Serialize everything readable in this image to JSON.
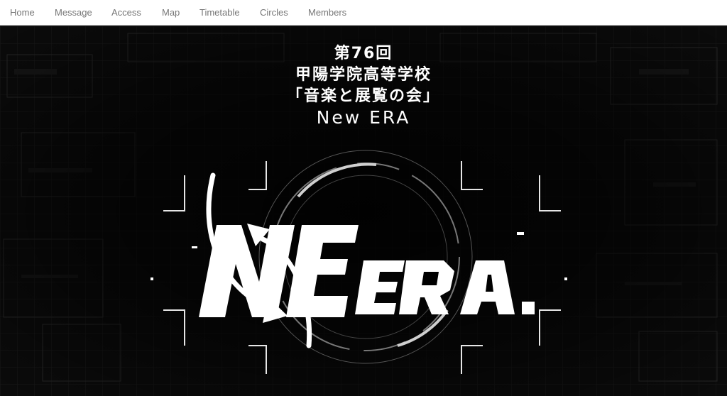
{
  "nav": {
    "items": [
      {
        "label": "Home"
      },
      {
        "label": "Message"
      },
      {
        "label": "Access"
      },
      {
        "label": "Map"
      },
      {
        "label": "Timetable"
      },
      {
        "label": "Circles"
      },
      {
        "label": "Members"
      }
    ]
  },
  "hero": {
    "title_lines": [
      "第76回",
      "甲陽学院高等学校",
      "「音楽と展覧の会」",
      "New ERA"
    ],
    "logo_text": "NEW ERA"
  },
  "colors": {
    "nav_background": "#ffffff",
    "nav_text": "#777777",
    "hero_background": "#000000",
    "hero_text": "#ffffff"
  }
}
